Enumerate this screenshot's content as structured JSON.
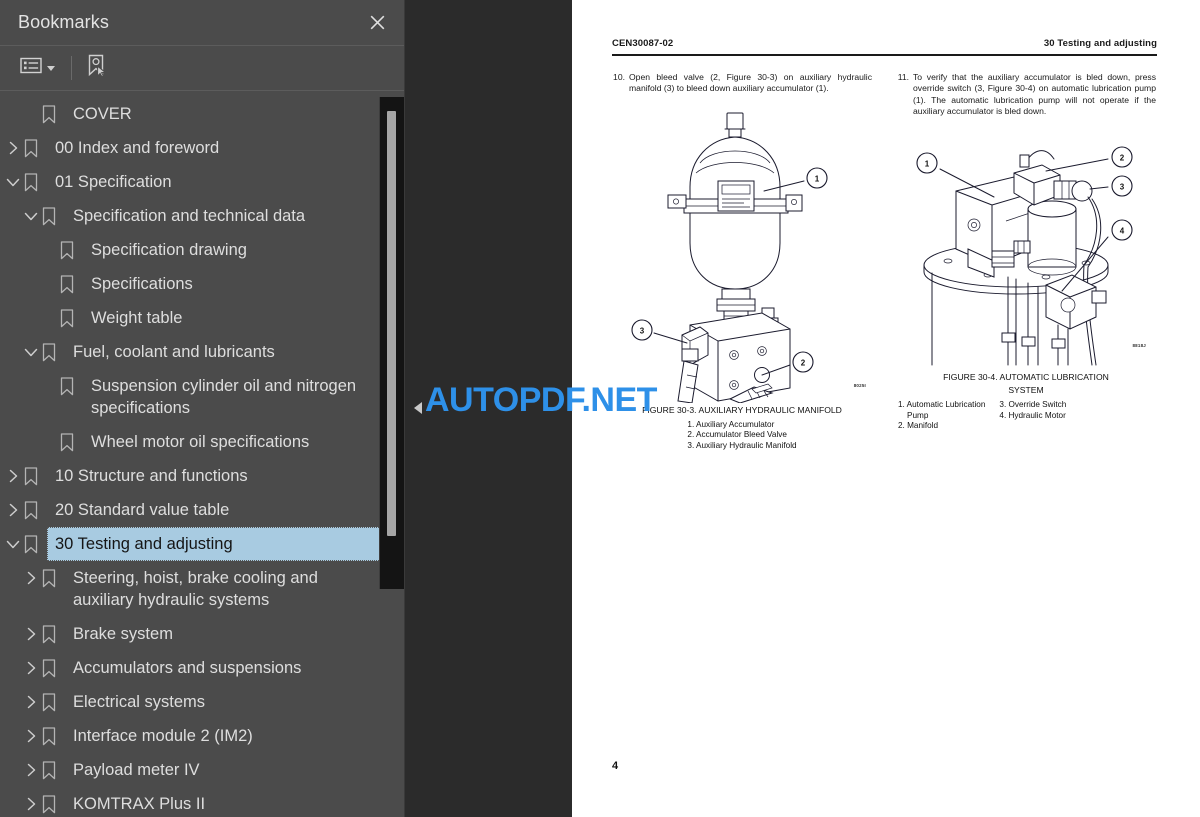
{
  "panel": {
    "title": "Bookmarks",
    "close_icon": "close-icon",
    "toolbar": {
      "options_icon": "list-options-icon",
      "dropdown_caret": "chevron-down-icon",
      "new_bookmark_icon": "new-bookmark-icon"
    }
  },
  "bookmarks": [
    {
      "label": "COVER",
      "indent": 1,
      "twisty": "none",
      "selected": false
    },
    {
      "label": "00 Index and foreword",
      "indent": 0,
      "twisty": "collapsed",
      "selected": false
    },
    {
      "label": "01 Specification",
      "indent": 0,
      "twisty": "expanded",
      "selected": false
    },
    {
      "label": "Specification and technical data",
      "indent": 1,
      "twisty": "expanded",
      "selected": false
    },
    {
      "label": "Specification drawing",
      "indent": 2,
      "twisty": "none",
      "selected": false
    },
    {
      "label": "Specifications",
      "indent": 2,
      "twisty": "none",
      "selected": false
    },
    {
      "label": "Weight table",
      "indent": 2,
      "twisty": "none",
      "selected": false
    },
    {
      "label": "Fuel, coolant and lubricants",
      "indent": 1,
      "twisty": "expanded",
      "selected": false
    },
    {
      "label": "Suspension cylinder oil and nitrogen specifications",
      "indent": 2,
      "twisty": "none",
      "selected": false
    },
    {
      "label": "Wheel motor oil specifications",
      "indent": 2,
      "twisty": "none",
      "selected": false
    },
    {
      "label": "10 Structure and functions",
      "indent": 0,
      "twisty": "collapsed",
      "selected": false
    },
    {
      "label": "20 Standard value table",
      "indent": 0,
      "twisty": "collapsed",
      "selected": false
    },
    {
      "label": "30 Testing and adjusting",
      "indent": 0,
      "twisty": "expanded",
      "selected": true
    },
    {
      "label": "Steering, hoist, brake cooling and auxiliary hydraulic systems",
      "indent": 1,
      "twisty": "collapsed",
      "selected": false
    },
    {
      "label": "Brake system",
      "indent": 1,
      "twisty": "collapsed",
      "selected": false
    },
    {
      "label": "Accumulators and suspensions",
      "indent": 1,
      "twisty": "collapsed",
      "selected": false
    },
    {
      "label": "Electrical systems",
      "indent": 1,
      "twisty": "collapsed",
      "selected": false
    },
    {
      "label": "Interface module 2 (IM2)",
      "indent": 1,
      "twisty": "collapsed",
      "selected": false
    },
    {
      "label": "Payload meter IV",
      "indent": 1,
      "twisty": "collapsed",
      "selected": false
    },
    {
      "label": "KOMTRAX Plus II",
      "indent": 1,
      "twisty": "collapsed",
      "selected": false
    }
  ],
  "document": {
    "header_left": "CEN30087-02",
    "header_right": "30 Testing and adjusting",
    "page_number": "4",
    "left_column": {
      "step_number": "10.",
      "step_text": "Open bleed valve (2, Figure 30-3) on auxiliary hydraulic manifold (3) to bleed down auxiliary accumulator (1).",
      "figure": {
        "id_code": "8025I",
        "caption": "FIGURE 30-3. AUXILIARY HYDRAULIC MANIFOLD",
        "callouts": [
          "1",
          "2",
          "3"
        ],
        "legend": [
          "1. Auxiliary Accumulator",
          "2. Accumulator Bleed Valve",
          "3. Auxiliary Hydraulic Manifold"
        ]
      }
    },
    "right_column": {
      "step_number": "11.",
      "step_text": "To verify that the auxiliary accumulator is bled down, press override switch (3, Figure 30-4) on automatic lubrication pump (1). The automatic lubrication pump will not operate if the auxiliary accumulator is bled down.",
      "figure": {
        "id_code": "8818J",
        "caption_line1": "FIGURE 30-4. AUTOMATIC LUBRICATION",
        "caption_line2": "SYSTEM",
        "callouts": [
          "1",
          "2",
          "3",
          "4"
        ],
        "legend_col1": [
          "1. Automatic Lubrication",
          "Pump",
          "2. Manifold"
        ],
        "legend_col2": [
          "3. Override Switch",
          "4. Hydraulic Motor"
        ]
      }
    }
  },
  "watermark": {
    "text": "AUTOPDF.NET",
    "color": "#2e90e8"
  },
  "collapse_handle_icon": "collapse-left-triangle-icon",
  "colors": {
    "panel_bg": "#4b4b4b",
    "viewer_bg": "#2b2b2b",
    "page_bg": "#ffffff",
    "selection": "#a8cbe1",
    "scrollbar_track": "#141414",
    "scrollbar_thumb": "#a6a6a6"
  }
}
